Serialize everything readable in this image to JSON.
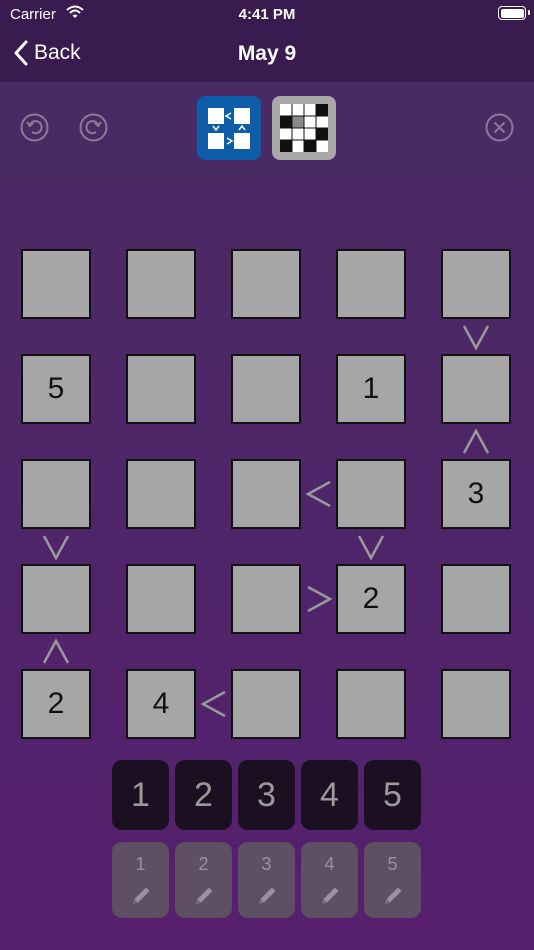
{
  "status_bar": {
    "carrier": "Carrier",
    "time": "4:41 PM"
  },
  "nav": {
    "back_label": "Back",
    "title": "May 9"
  },
  "toolbar": {
    "undo_icon": "undo-icon",
    "redo_icon": "redo-icon",
    "close_icon": "close-icon"
  },
  "modes": [
    {
      "name": "inequality-mode",
      "active": true
    },
    {
      "name": "grid-mode",
      "active": false
    }
  ],
  "grid": {
    "size": 5,
    "cells": [
      [
        "",
        "",
        "",
        "",
        ""
      ],
      [
        "5",
        "",
        "",
        "1",
        ""
      ],
      [
        "",
        "",
        "",
        "",
        "3"
      ],
      [
        "",
        "",
        "",
        "2",
        ""
      ],
      [
        "2",
        "4",
        "",
        "",
        ""
      ]
    ],
    "horizontal_constraints": [
      {
        "row": 2,
        "between": [
          2,
          3
        ],
        "symbol": "<"
      },
      {
        "row": 3,
        "between": [
          2,
          3
        ],
        "symbol": ">"
      },
      {
        "row": 4,
        "between": [
          1,
          2
        ],
        "symbol": "<"
      }
    ],
    "vertical_constraints": [
      {
        "col": 4,
        "between": [
          0,
          1
        ],
        "symbol": "v"
      },
      {
        "col": 4,
        "between": [
          1,
          2
        ],
        "symbol": "^"
      },
      {
        "col": 0,
        "between": [
          2,
          3
        ],
        "symbol": "v"
      },
      {
        "col": 3,
        "between": [
          2,
          3
        ],
        "symbol": "v"
      },
      {
        "col": 0,
        "between": [
          3,
          4
        ],
        "symbol": "^"
      }
    ]
  },
  "keypad": {
    "numbers": [
      "1",
      "2",
      "3",
      "4",
      "5"
    ],
    "notes": [
      "1",
      "2",
      "3",
      "4",
      "5"
    ]
  },
  "colors": {
    "background": "#4d2768",
    "nav": "#3a1b4f",
    "cell": "#a6a6a6",
    "active_mode": "#0e5da8"
  }
}
